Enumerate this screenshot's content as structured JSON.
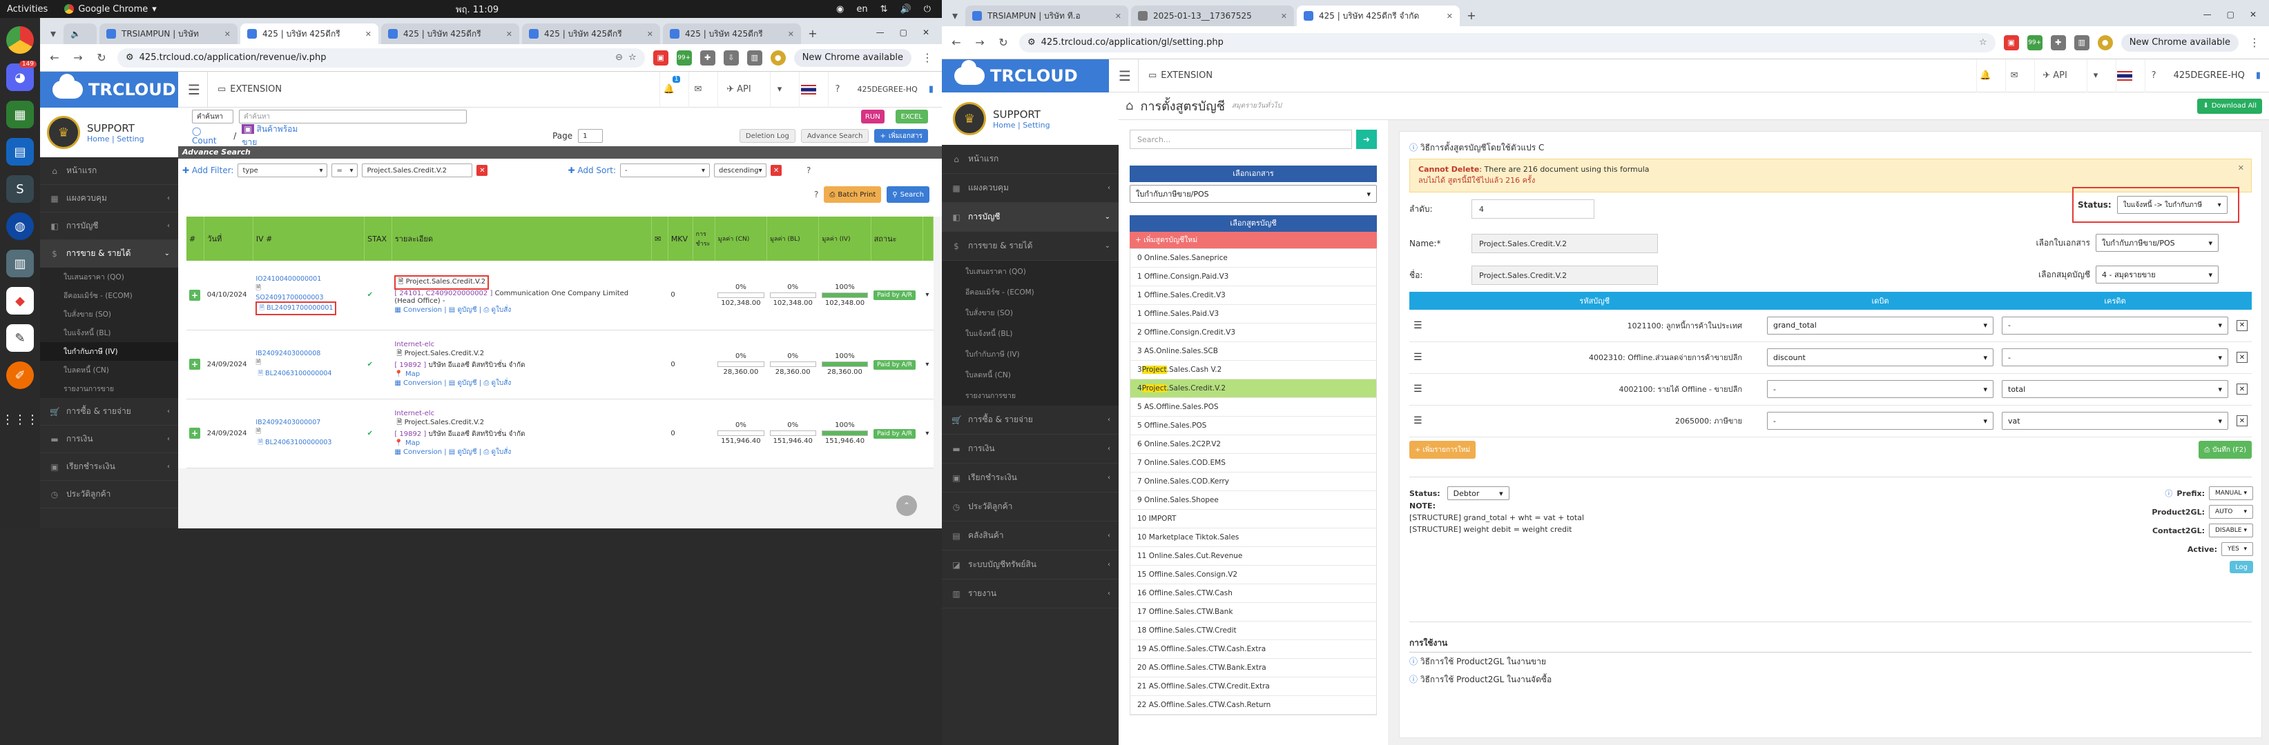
{
  "system": {
    "activities": "Activities",
    "app_name": "Google Chrome",
    "clock": "พฤ. 11:09",
    "lang": "en"
  },
  "dock": {
    "badge": "149"
  },
  "left_window": {
    "tabs": [
      {
        "label": "TRSIAMPUN | บริษัท"
      },
      {
        "label": "425 | บริษัท 425ดีกรี"
      },
      {
        "label": "425 | บริษัท 425ดีกรี"
      },
      {
        "label": "425 | บริษัท 425ดีกรี"
      },
      {
        "label": "425 | บริษัท 425ดีกรี"
      }
    ],
    "url": "425.trcloud.co/application/revenue/iv.php",
    "ext_badge": "99+",
    "chrome_available": "New Chrome available"
  },
  "right_window": {
    "tabs": [
      {
        "label": "TRSIAMPUN | บริษัท ที.อ"
      },
      {
        "label": "2025-01-13__17367525"
      },
      {
        "label": "425 | บริษัท 425ดีกรี จำกัด"
      }
    ],
    "url": "425.trcloud.co/application/gl/setting.php",
    "ext_badge": "99+",
    "chrome_available": "New Chrome available"
  },
  "app": {
    "brand": "TRCLOUD",
    "extension": "EXTENSION",
    "api": "API",
    "company": "425DEGREE-HQ",
    "notif_badge": "1",
    "user_name": "SUPPORT",
    "home": "Home",
    "setting": "Setting"
  },
  "left_sidebar": {
    "items": [
      {
        "label": "หน้าแรก"
      },
      {
        "label": "แผงควบคุม"
      },
      {
        "label": "การบัญชี"
      },
      {
        "label": "การขาย & รายได้"
      }
    ],
    "subs": [
      {
        "label": "ใบเสนอราคา (QO)"
      },
      {
        "label": "อีคอมเมิร์ซ - (ECOM)"
      },
      {
        "label": "ใบสั่งขาย (SO)"
      },
      {
        "label": "ใบแจ้งหนี้ (BL)"
      },
      {
        "label": "ใบกำกับภาษี (IV)"
      },
      {
        "label": "ใบลดหนี้ (CN)"
      },
      {
        "label": "รายงานการขาย"
      }
    ],
    "tail": [
      {
        "label": "การซื้อ & รายจ่าย"
      },
      {
        "label": "การเงิน"
      },
      {
        "label": "เรียกชำระเงิน"
      },
      {
        "label": "ประวัติลูกค้า"
      }
    ]
  },
  "iv_page": {
    "filter_label": "คำค้นหา",
    "filter_placeholder": "คำค้นหา",
    "run": "RUN",
    "excel": "EXCEL",
    "count": "Count",
    "product_ready": "สินค้าพร้อมขาย",
    "page_label": "Page",
    "page": "1",
    "deletion_log": "Deletion Log",
    "advance_search_btn": "Advance Search",
    "add_doc": "เพิ่มเอกสาร",
    "advance_search": "Advance Search",
    "add_filter": "Add Filter:",
    "filter_field": "type",
    "filter_op": "=",
    "filter_value": "Project.Sales.Credit.V.2",
    "add_sort": "Add Sort:",
    "sort_field": "-",
    "sort_dir": "descending",
    "batch_print": "Batch Print",
    "search": "Search",
    "headers": {
      "no": "#",
      "date": "วันที่",
      "iv": "IV #",
      "stax": "STAX",
      "detail": "รายละเอียด",
      "mail": "✉",
      "mkv": "MKV",
      "pay": "การ ชำระ",
      "cn": "มูลค่า (CN)",
      "bl": "มูลค่า (BL)",
      "iv_val": "มูลค่า (IV)",
      "status": "สถานะ"
    },
    "rows": [
      {
        "date": "04/10/2024",
        "iv": "IO24100400000001",
        "so": "SO24091700000003",
        "bl": "BL24091700000001",
        "tag": "Project.Sales.Credit.V.2",
        "code": "[ 24101, C2409020000002 ]",
        "customer": "Communication One Company Limited (Head Office) -",
        "convert": "Conversion",
        "journal": "ดูบัญชี",
        "print": "ดูใบสั่ง",
        "zero": "0",
        "cn_pct": "0%",
        "bl_pct": "0%",
        "iv_pct": "100%",
        "cn": "102,348.00",
        "bl_v": "102,348.00",
        "iv_v": "102,348.00",
        "status": "Paid by A/R",
        "fill": 1.0
      },
      {
        "date": "24/09/2024",
        "iv": "IB24092403000008",
        "so": "",
        "bl": "BL24063100000004",
        "tag": "Project.Sales.Credit.V.2",
        "code": "[ 19892 ]",
        "customer": "บริษัท อีแอลซี ดิสทริบิวชั่น จำกัด",
        "map": "Map",
        "convert": "Conversion",
        "journal": "ดูบัญชี",
        "print": "ดูใบสั่ง",
        "internet": "Internet-elc",
        "zero": "0",
        "cn_pct": "0%",
        "bl_pct": "0%",
        "iv_pct": "100%",
        "cn": "28,360.00",
        "bl_v": "28,360.00",
        "iv_v": "28,360.00",
        "status": "Paid by A/R",
        "fill": 1.0
      },
      {
        "date": "24/09/2024",
        "iv": "IB24092403000007",
        "so": "",
        "bl": "BL24063100000003",
        "tag": "Project.Sales.Credit.V.2",
        "code": "[ 19892 ]",
        "customer": "บริษัท อีแอลซี ดิสทริบิวชั่น จำกัด",
        "map": "Map",
        "convert": "Conversion",
        "journal": "ดูบัญชี",
        "print": "ดูใบสั่ง",
        "internet": "Internet-elc",
        "zero": "0",
        "cn_pct": "0%",
        "bl_pct": "0%",
        "iv_pct": "100%",
        "cn": "151,946.40",
        "bl_v": "151,946.40",
        "iv_v": "151,946.40",
        "status": "Paid by A/R",
        "fill": 1.0
      }
    ]
  },
  "right_sidebar": {
    "items": [
      {
        "label": "หน้าแรก"
      },
      {
        "label": "แผงควบคุม"
      },
      {
        "label": "การบัญชี"
      },
      {
        "label": "การขาย & รายได้"
      }
    ],
    "subs": [
      {
        "label": "ใบเสนอราคา (QO)"
      },
      {
        "label": "อีคอมเมิร์ซ - (ECOM)"
      },
      {
        "label": "ใบสั่งขาย (SO)"
      },
      {
        "label": "ใบแจ้งหนี้ (BL)"
      },
      {
        "label": "ใบกำกับภาษี (IV)"
      },
      {
        "label": "ใบลดหนี้ (CN)"
      },
      {
        "label": "รายงานการขาย"
      }
    ],
    "tail": [
      {
        "label": "การซื้อ & รายจ่าย"
      },
      {
        "label": "การเงิน"
      },
      {
        "label": "เรียกชำระเงิน"
      },
      {
        "label": "ประวัติลูกค้า"
      },
      {
        "label": "คลังสินค้า"
      },
      {
        "label": "ระบบบัญชีทรัพย์สิน"
      },
      {
        "label": "รายงาน"
      }
    ]
  },
  "gl_page": {
    "title": "การตั้งสูตรบัญชี",
    "subtitle": "สมุดรายวันทั่วไป",
    "download_all": "Download All",
    "search_placeholder": "Search...",
    "select_doc_header": "เลือกเอกสาร",
    "doc_value": "ใบกำกับภาษีขาย/POS",
    "select_formula_header": "เลือกสูตรบัญชี",
    "add_formula": "+ เพิ่มสูตรบัญชีใหม่",
    "formulas": [
      "0 Online.Sales.Saneprice",
      "1 Offline.Consign.Paid.V3",
      "1 Offline.Sales.Credit.V3",
      "1 Offline.Sales.Paid.V3",
      "2 Offline.Consign.Credit.V3",
      "3 AS.Online.Sales.SCB",
      "3 Project.Sales.Cash V.2",
      "4 Project.Sales.Credit.V.2",
      "5 AS.Offline.Sales.POS",
      "5 Offline.Sales.POS",
      "6 Online.Sales.2C2P.V2",
      "7 Online.Sales.COD.EMS",
      "7 Online.Sales.COD.Kerry",
      "9 Online.Sales.Shopee",
      "10 IMPORT",
      "10 Marketplace Tiktok.Sales",
      "11 Online.Sales.Cut.Revenue",
      "15 Offline.Sales.Consign.V2",
      "16 Offline.Sales.CTW.Cash",
      "17 Offline.Sales.CTW.Bank",
      "18 Offline.Sales.CTW.Credit",
      "19 AS.Offline.Sales.CTW.Cash.Extra",
      "20 AS.Offline.Sales.CTW.Bank.Extra",
      "21 AS.Offline.Sales.CTW.Credit.Extra",
      "22 AS.Offline.Sales.CTW.Cash.Return"
    ],
    "formula_name_title": "วิธีการตั้งสูตรบัญชีโดยใช้ตัวแปร C",
    "cannot_delete_label": "Cannot Delete",
    "cannot_delete_msg": ": There are 216 document using this formula",
    "cannot_delete_th": "ลบไม่ได้ สูตรนี้มีใช้ไปแล้ว 216 ครั้ง",
    "order_label": "ลำดับ:",
    "order_value": "4",
    "status_label": "Status:",
    "status_value": "ใบแจ้งหนี้ -> ใบกำกับภาษี",
    "name_label": "Name:*",
    "name_value": "Project.Sales.Credit.V.2",
    "th_name_label": "ชื่อ:",
    "th_name_value": "Project.Sales.Credit.V.2",
    "doc_type_label": "เลือกใบเอกสาร",
    "doc_type_value": "ใบกำกับภาษีขาย/POS",
    "journal_label": "เลือกสมุดบัญชี",
    "journal_value": "4 - สมุดรายขาย",
    "col_account": "รหัสบัญชี",
    "col_debit": "เดบิต",
    "col_credit": "เครดิต",
    "lines": [
      {
        "account": "1021100: ลูกหนี้การค้าในประเทศ",
        "debit": "grand_total",
        "credit": "-"
      },
      {
        "account": "4002310: Offline.ส่วนลดจ่ายการค้าขายปลีก",
        "debit": "discount",
        "credit": "-"
      },
      {
        "account": "4002100: รายได้ Offline - ขายปลีก",
        "debit": "-",
        "credit": "total"
      },
      {
        "account": "2065000: ภาษีขาย",
        "debit": "-",
        "credit": "vat"
      }
    ],
    "add_line": "+ เพิ่มรายการใหม่",
    "save": "บันทึก (F2)",
    "status2_label": "Status:",
    "status2_value": "Debtor",
    "note_label": "NOTE:",
    "structure1": "[STRUCTURE] grand_total + wht = vat + total",
    "structure2": "[STRUCTURE] weight debit = weight credit",
    "prefix_label": "Prefix:",
    "prefix_value": "MANUAL",
    "product2gl_label": "Product2GL:",
    "product2gl_value": "AUTO",
    "contact2gl_label": "Contact2GL:",
    "contact2gl_value": "DISABLE",
    "active_label": "Active:",
    "active_value": "YES",
    "log": "Log",
    "usage_header": "การใช้งาน",
    "usage1": "วิธีการใช้ Product2GL ในงานขาย",
    "usage2": "วิธีการใช้ Product2GL ในงานจัดซื้อ"
  },
  "colors": {
    "brand_blue": "#3a7bd5",
    "table_green": "#7cc244",
    "gl_header": "#1ea5e0",
    "highlight": "#b5e07e",
    "danger": "#e53935"
  }
}
